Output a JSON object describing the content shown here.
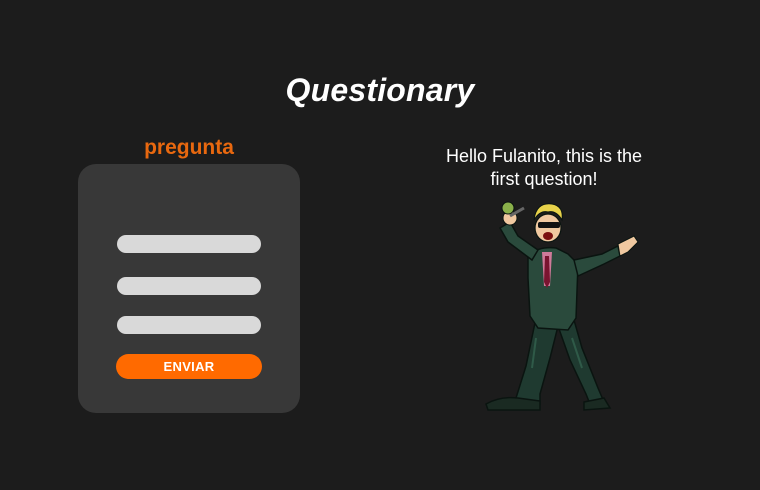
{
  "header": {
    "title": "Questionary"
  },
  "form": {
    "question_label": "pregunta",
    "fields": [
      {
        "value": "",
        "placeholder": ""
      },
      {
        "value": "",
        "placeholder": ""
      },
      {
        "value": "",
        "placeholder": ""
      }
    ],
    "submit_label": "ENVIAR"
  },
  "prompt": {
    "greeting_line1": "Hello Fulanito, this is the",
    "greeting_line2": "first question!"
  },
  "character": {
    "icon": "singing-character-illustration"
  },
  "colors": {
    "background": "#1c1c1c",
    "card": "#383838",
    "accent": "#ff6a00",
    "label": "#e8680f",
    "field": "#d9d9d9"
  }
}
